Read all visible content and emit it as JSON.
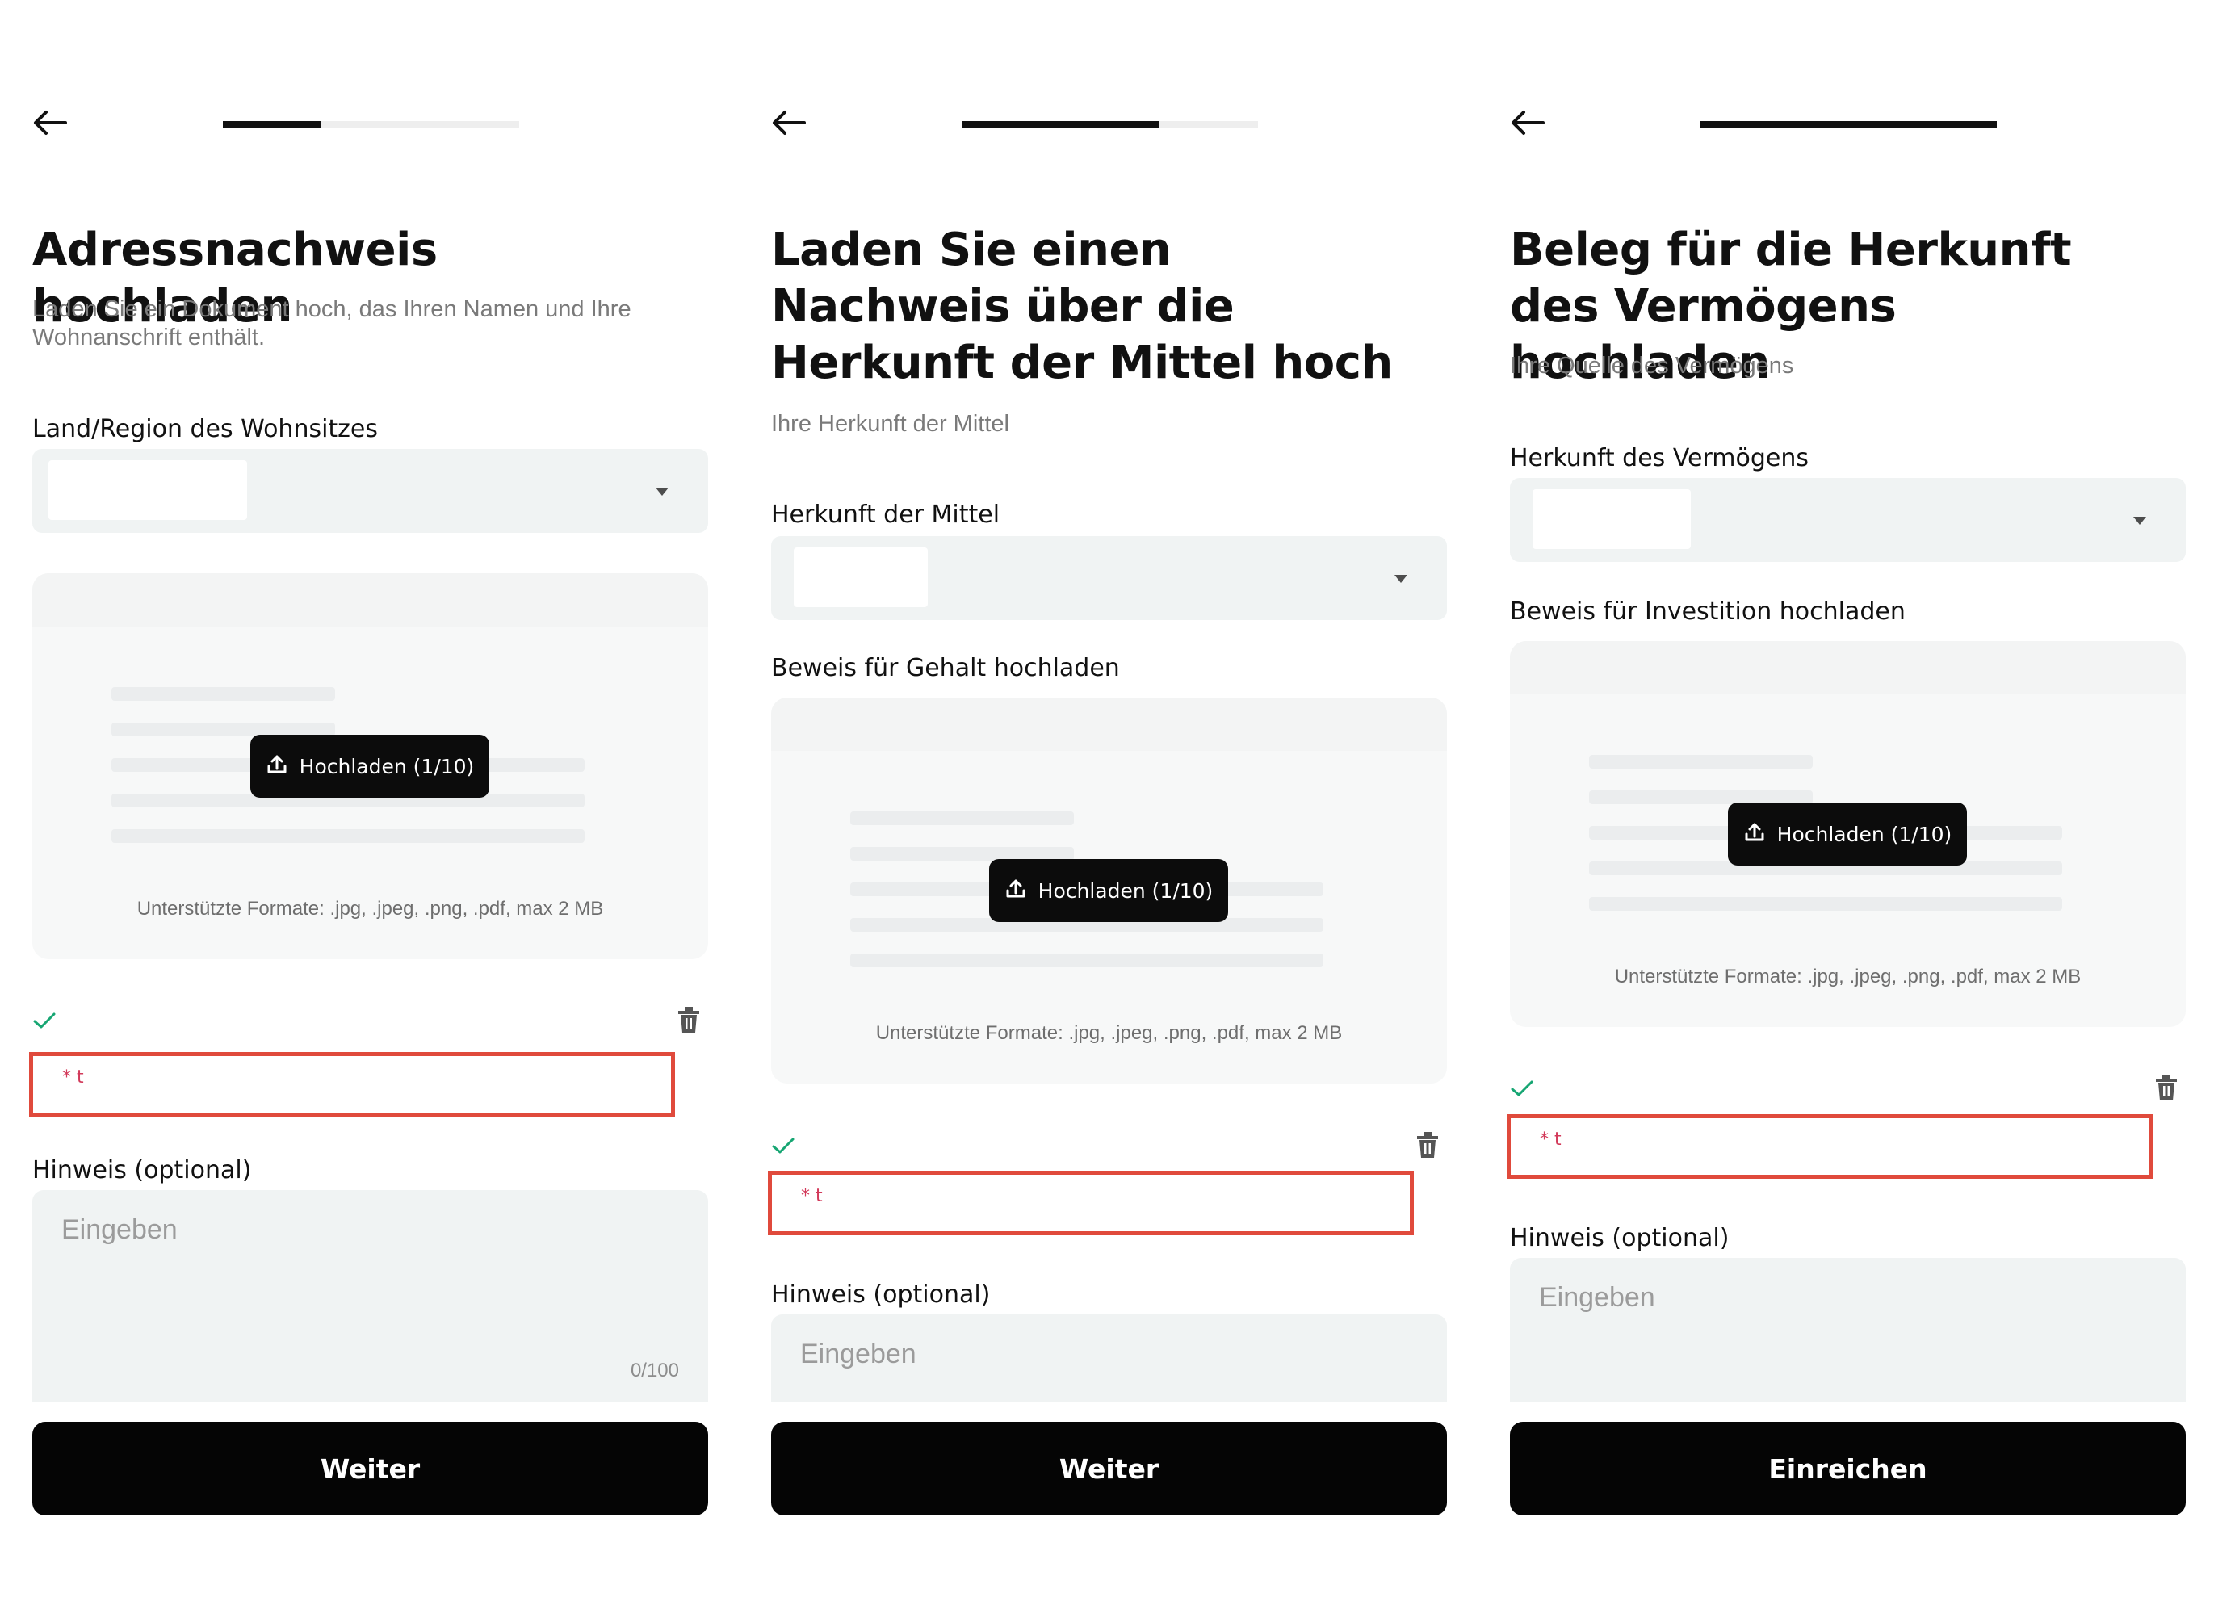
{
  "screens": [
    {
      "progress": 0.33,
      "title": "Adressnachweis hochladen",
      "subtitle": "Laden Sie ein Dokument hoch, das Ihren Namen und Ihre Wohnanschrift enthält.",
      "select_label": "Land/Region des Wohnsitzes",
      "upload_label": "",
      "upload_button": "Hochladen (1/10)",
      "formats": "Unterstützte Formate: .jpg, .jpeg, .png, .pdf, max 2 MB",
      "required_marker": "* t",
      "note_label": "Hinweis (optional)",
      "note_placeholder": "Eingeben",
      "note_counter": "0/100",
      "primary_button": "Weiter"
    },
    {
      "progress": 0.67,
      "title": "Laden Sie einen Nachweis über die Herkunft der Mittel hoch",
      "subtitle": "Ihre Herkunft der Mittel",
      "select_label": "Herkunft der Mittel",
      "upload_label": "Beweis für Gehalt hochladen",
      "upload_button": "Hochladen (1/10)",
      "formats": "Unterstützte Formate: .jpg, .jpeg, .png, .pdf, max 2 MB",
      "required_marker": "* t",
      "note_label": "Hinweis (optional)",
      "note_placeholder": "Eingeben",
      "primary_button": "Weiter"
    },
    {
      "progress": 1.0,
      "title": "Beleg für die Herkunft des Vermögens hochladen",
      "subtitle": "Ihre Quelle des Vermögens",
      "select_label": "Herkunft des Vermögens",
      "upload_label": "Beweis für Investition hochladen",
      "upload_button": "Hochladen (1/10)",
      "formats": "Unterstützte Formate: .jpg, .jpeg, .png, .pdf, max 2 MB",
      "required_marker": "* t",
      "note_label": "Hinweis (optional)",
      "note_placeholder": "Eingeben",
      "primary_button": "Einreichen"
    }
  ],
  "icons": {
    "back": "arrow-left-icon",
    "caret": "caret-down-icon",
    "upload": "upload-icon",
    "check": "check-icon",
    "trash": "trash-icon"
  },
  "colors": {
    "primary": "#050505",
    "field_bg": "#f0f3f3",
    "error_border": "#e04a3c",
    "success": "#17a673"
  }
}
